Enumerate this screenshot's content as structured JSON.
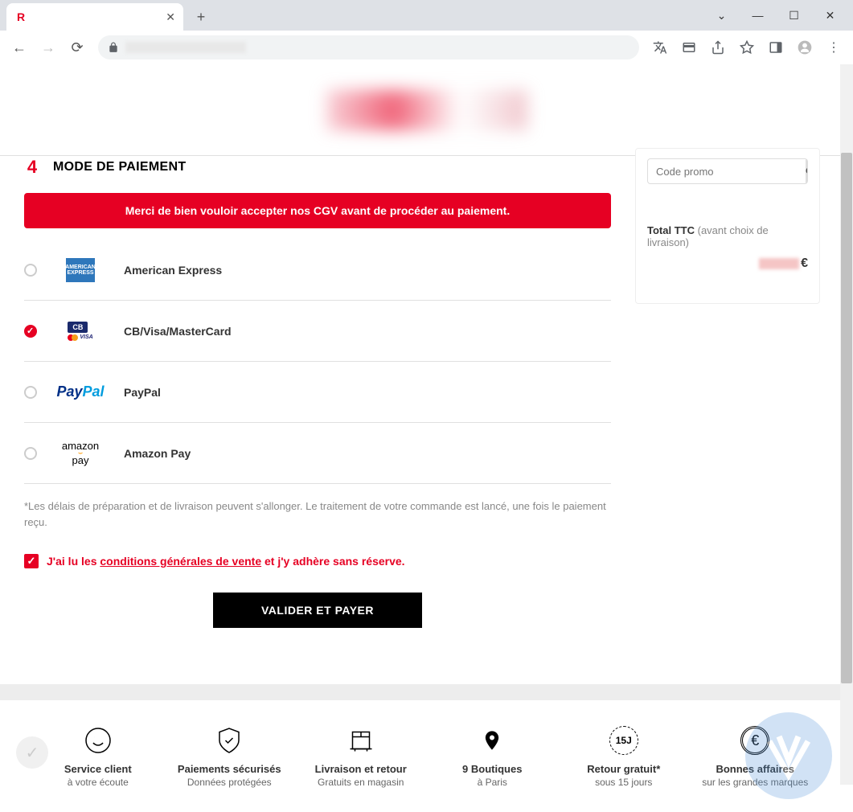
{
  "browser": {
    "tab_favicon": "R",
    "tab_title": "",
    "window": {
      "min": "—",
      "max": "☐",
      "close": "✕",
      "chevron": "⌄"
    }
  },
  "section": {
    "step_number": "4",
    "title": "MODE DE PAIEMENT"
  },
  "alert": "Merci de bien vouloir accepter nos CGV avant de procéder au paiement.",
  "payment_options": [
    {
      "id": "amex",
      "label": "American Express",
      "selected": false
    },
    {
      "id": "cb",
      "label": "CB/Visa/MasterCard",
      "selected": true
    },
    {
      "id": "paypal",
      "label": "PayPal",
      "selected": false
    },
    {
      "id": "amazonpay",
      "label": "Amazon Pay",
      "selected": false
    }
  ],
  "disclaimer": "*Les délais de préparation et de livraison peuvent s'allonger. Le traitement de votre commande est lancé, une fois le paiement reçu.",
  "terms": {
    "prefix": "J'ai lu les ",
    "link": "conditions générales de vente",
    "suffix": " et j'y adhère sans réserve.",
    "checked": true
  },
  "pay_button": "VALIDER ET PAYER",
  "sidebar": {
    "promo_placeholder": "Code promo",
    "promo_btn": "OK",
    "total_label": "Total TTC",
    "total_note": "(avant choix de livraison)",
    "currency": "€"
  },
  "footer": [
    {
      "title": "Service client",
      "sub": "à votre écoute"
    },
    {
      "title": "Paiements sécurisés",
      "sub": "Données protégées"
    },
    {
      "title": "Livraison et retour",
      "sub": "Gratuits en magasin"
    },
    {
      "title": "9 Boutiques",
      "sub": "à Paris"
    },
    {
      "title": "Retour gratuit*",
      "sub": "sous 15 jours",
      "badge": "15J"
    },
    {
      "title": "Bonnes affaires",
      "sub": "sur les grandes marques"
    }
  ]
}
